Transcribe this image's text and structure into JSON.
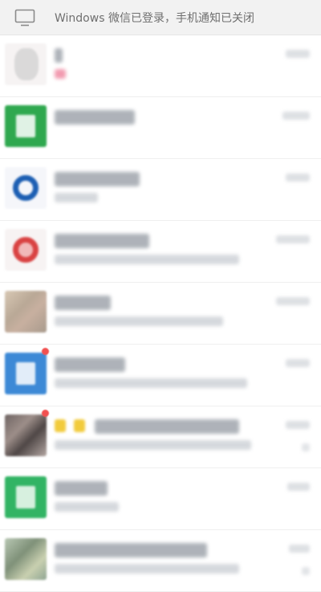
{
  "banner": {
    "text": "Windows 微信已登录，手机通知已关闭",
    "icon": "monitor-icon"
  },
  "chats": [
    {
      "avatar": "a-white",
      "style": "white",
      "title_w": 10,
      "sub_w": 14,
      "sub_pink": true,
      "time_w": 30,
      "badge": false,
      "mute": false
    },
    {
      "avatar": "a-green",
      "style": "doc",
      "title_w": 100,
      "sub_w": 0,
      "sub_pink": false,
      "time_w": 34,
      "badge": false,
      "mute": false
    },
    {
      "avatar": "a-white2",
      "style": "ring-blue",
      "title_w": 106,
      "sub_w": 54,
      "sub_pink": false,
      "time_w": 30,
      "badge": false,
      "mute": false
    },
    {
      "avatar": "a-white3",
      "style": "ring-red",
      "title_w": 118,
      "sub_w": 230,
      "sub_pink": false,
      "time_w": 42,
      "badge": false,
      "mute": false
    },
    {
      "avatar": "a-photo1",
      "style": "photo",
      "title_w": 70,
      "sub_w": 210,
      "sub_pink": false,
      "time_w": 42,
      "badge": false,
      "mute": false
    },
    {
      "avatar": "a-blue",
      "style": "doc",
      "title_w": 88,
      "sub_w": 240,
      "sub_pink": false,
      "time_w": 30,
      "badge": true,
      "mute": false
    },
    {
      "avatar": "a-photo2",
      "style": "photo",
      "title_w": 180,
      "sub_w": 245,
      "sub_pink": false,
      "time_w": 30,
      "badge": true,
      "mute": true
    },
    {
      "avatar": "a-green2",
      "style": "doc-green",
      "title_w": 66,
      "sub_w": 80,
      "sub_pink": false,
      "time_w": 28,
      "badge": false,
      "mute": false
    },
    {
      "avatar": "a-photo3",
      "style": "photo",
      "title_w": 190,
      "sub_w": 230,
      "sub_pink": false,
      "time_w": 26,
      "badge": false,
      "mute": true
    }
  ]
}
